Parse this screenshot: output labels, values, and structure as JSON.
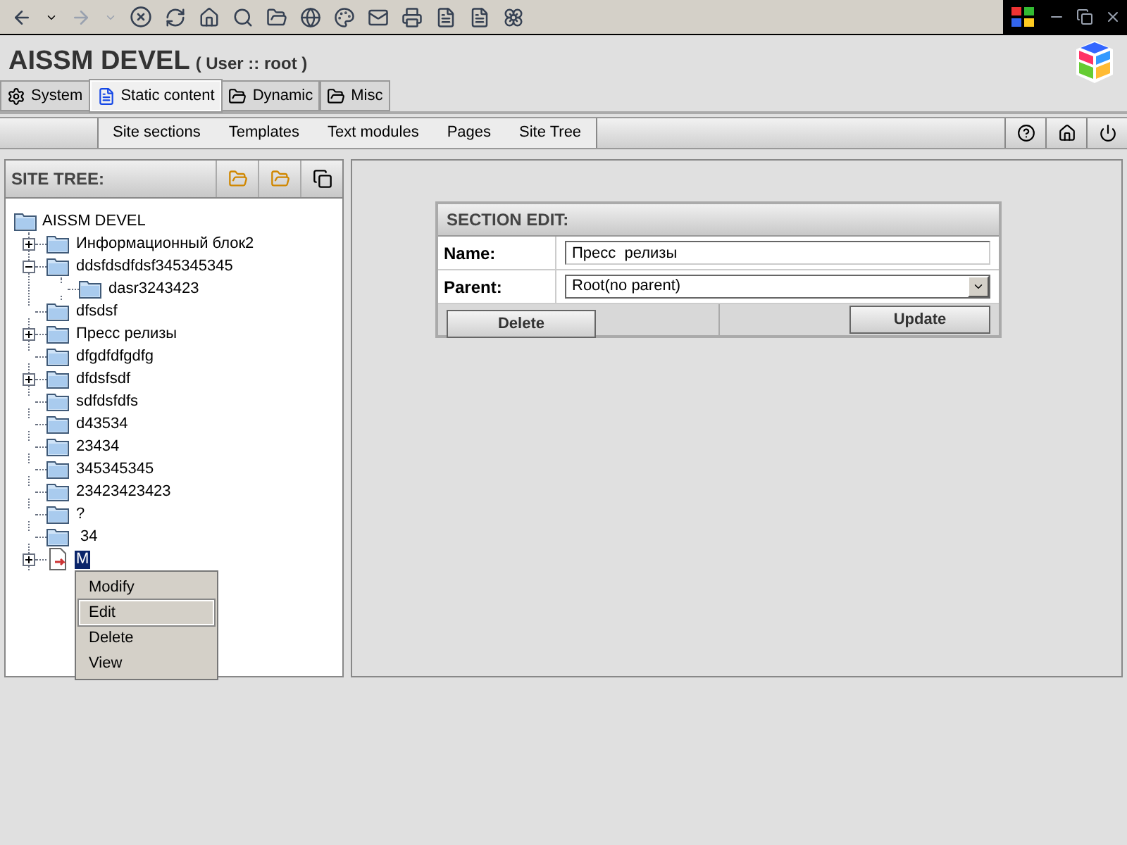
{
  "app": {
    "title": "AISSM DEVEL",
    "user": "( User :: root )"
  },
  "tabs": [
    {
      "label": "System",
      "selected": false
    },
    {
      "label": "Static content",
      "selected": true
    },
    {
      "label": "Dynamic",
      "selected": false
    },
    {
      "label": "Misc",
      "selected": false
    }
  ],
  "subnav": [
    {
      "label": "Site sections"
    },
    {
      "label": "Templates"
    },
    {
      "label": "Text modules"
    },
    {
      "label": "Pages"
    },
    {
      "label": "Site Tree"
    }
  ],
  "site_tree": {
    "title": "SITE TREE:",
    "root": "AISSM DEVEL",
    "items": [
      {
        "label": "Информационный блок2",
        "kind": "folder",
        "expanded": false,
        "selected": false
      },
      {
        "label": "ddsfdsdfdsf345345345",
        "kind": "folder",
        "expanded": true,
        "selected": false,
        "children": [
          {
            "label": "dasr3243423",
            "kind": "folder",
            "selected": false
          }
        ]
      },
      {
        "label": "dfsdsf",
        "kind": "folder",
        "selected": false
      },
      {
        "label": "Пресс релизы",
        "kind": "folder",
        "expanded": false,
        "selected": false
      },
      {
        "label": "dfgdfdfgdfg",
        "kind": "folder",
        "selected": false
      },
      {
        "label": "dfdsfsdf",
        "kind": "folder",
        "expanded": false,
        "selected": false
      },
      {
        "label": "sdfdsfdfs",
        "kind": "folder",
        "selected": false
      },
      {
        "label": "d43534",
        "kind": "folder",
        "selected": false
      },
      {
        "label": "23434",
        "kind": "folder",
        "selected": false
      },
      {
        "label": "345345345",
        "kind": "folder",
        "selected": false
      },
      {
        "label": "23423423423",
        "kind": "folder",
        "selected": false
      },
      {
        "label": "?",
        "kind": "folder",
        "selected": false
      },
      {
        "label": " 34",
        "kind": "folder",
        "selected": false
      },
      {
        "label": "M",
        "kind": "page",
        "expanded": false,
        "selected": true
      }
    ]
  },
  "context_menu": {
    "items": [
      {
        "label": "Modify",
        "selected": false
      },
      {
        "label": "Edit",
        "selected": true
      },
      {
        "label": "Delete",
        "selected": false
      },
      {
        "label": "View",
        "selected": false
      }
    ]
  },
  "section_edit": {
    "title": "SECTION EDIT:",
    "name_label": "Name:",
    "name_value": "Пресс  релизы",
    "parent_label": "Parent:",
    "parent_value": "Root(no parent)",
    "delete_button": "Delete",
    "update_button": "Update"
  }
}
